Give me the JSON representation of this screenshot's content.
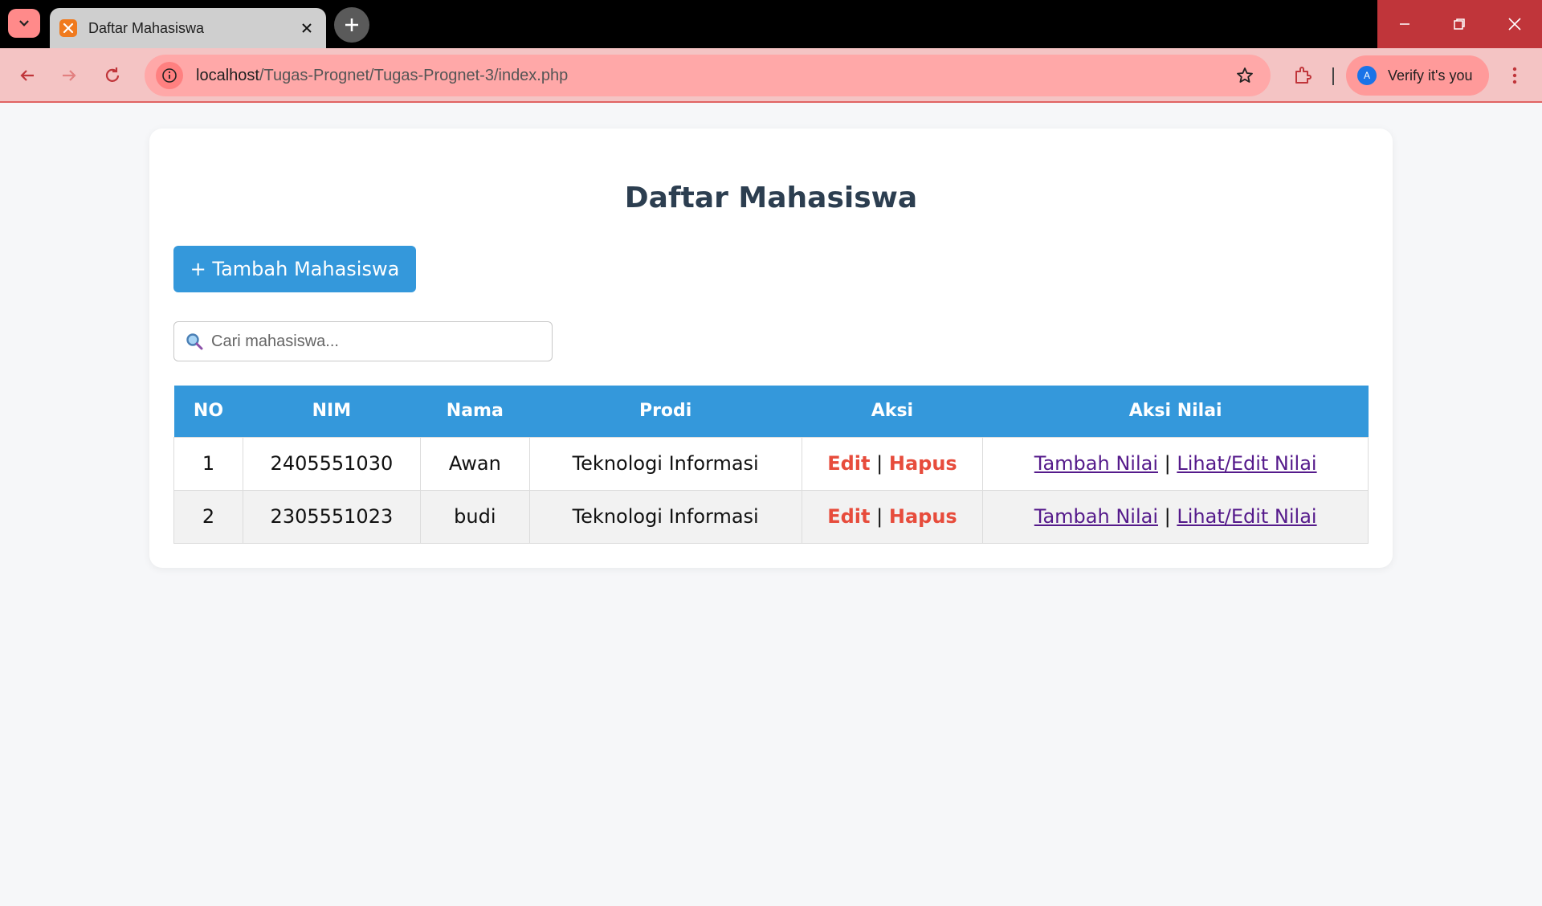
{
  "browser": {
    "tab_title": "Daftar Mahasiswa",
    "url_host": "localhost",
    "url_path": "/Tugas-Prognet/Tugas-Prognet-3/index.php",
    "profile_initial": "A",
    "profile_label": "Verify it's you"
  },
  "page": {
    "title": "Daftar Mahasiswa",
    "add_button": "+ Tambah Mahasiswa",
    "search_placeholder": "Cari mahasiswa..."
  },
  "table": {
    "headers": [
      "NO",
      "NIM",
      "Nama",
      "Prodi",
      "Aksi",
      "Aksi Nilai"
    ],
    "separator": "|",
    "rows": [
      {
        "no": "1",
        "nim": "2405551030",
        "nama": "Awan",
        "prodi": "Teknologi Informasi",
        "edit": "Edit",
        "hapus": "Hapus",
        "tambah_nilai": "Tambah Nilai",
        "lihat_nilai": "Lihat/Edit Nilai"
      },
      {
        "no": "2",
        "nim": "2305551023",
        "nama": "budi",
        "prodi": "Teknologi Informasi",
        "edit": "Edit",
        "hapus": "Hapus",
        "tambah_nilai": "Tambah Nilai",
        "lihat_nilai": "Lihat/Edit Nilai"
      }
    ]
  },
  "colors": {
    "primary": "#3498db",
    "danger": "#e74c3c",
    "title": "#2c3e50",
    "link": "#551a8b"
  },
  "icons": [
    "chevron-down-icon",
    "xampp-favicon-icon",
    "close-icon",
    "plus-icon",
    "minimize-icon",
    "restore-icon",
    "back-icon",
    "forward-icon",
    "reload-icon",
    "site-info-icon",
    "star-icon",
    "extensions-icon",
    "more-icon",
    "search-icon"
  ]
}
